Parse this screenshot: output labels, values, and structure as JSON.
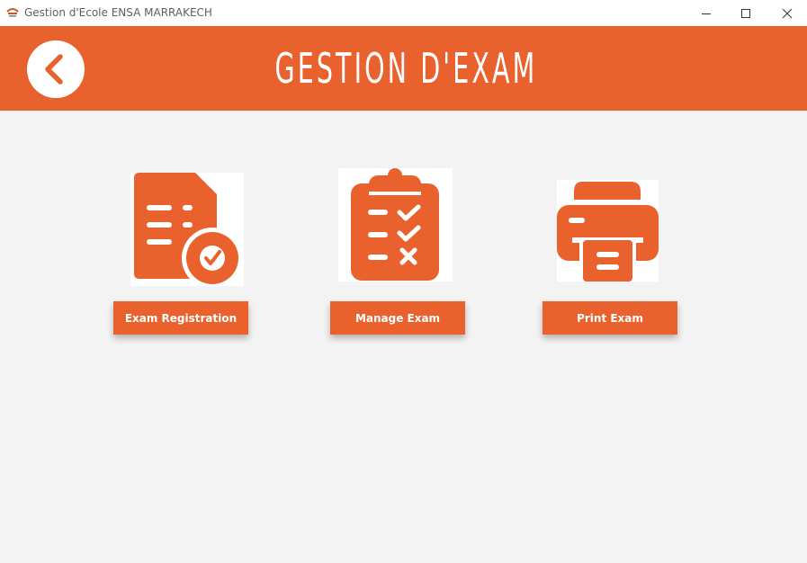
{
  "window": {
    "title": "Gestion d'Ecole ENSA MARRAKECH",
    "app_icon": "school-logo-icon",
    "controls": [
      "minimize-icon",
      "maximize-icon",
      "close-icon"
    ]
  },
  "header": {
    "title": "GESTION D'EXAM",
    "back_icon": "chevron-left-icon",
    "background_color": "#e9622e"
  },
  "actions": [
    {
      "label": "Exam Registration",
      "icon": "document-check-icon"
    },
    {
      "label": "Manage Exam",
      "icon": "clipboard-checklist-icon"
    },
    {
      "label": "Print Exam",
      "icon": "printer-icon"
    }
  ],
  "colors": {
    "accent": "#e9622e",
    "background": "#f3f3f3",
    "titlebar": "#ffffff"
  }
}
